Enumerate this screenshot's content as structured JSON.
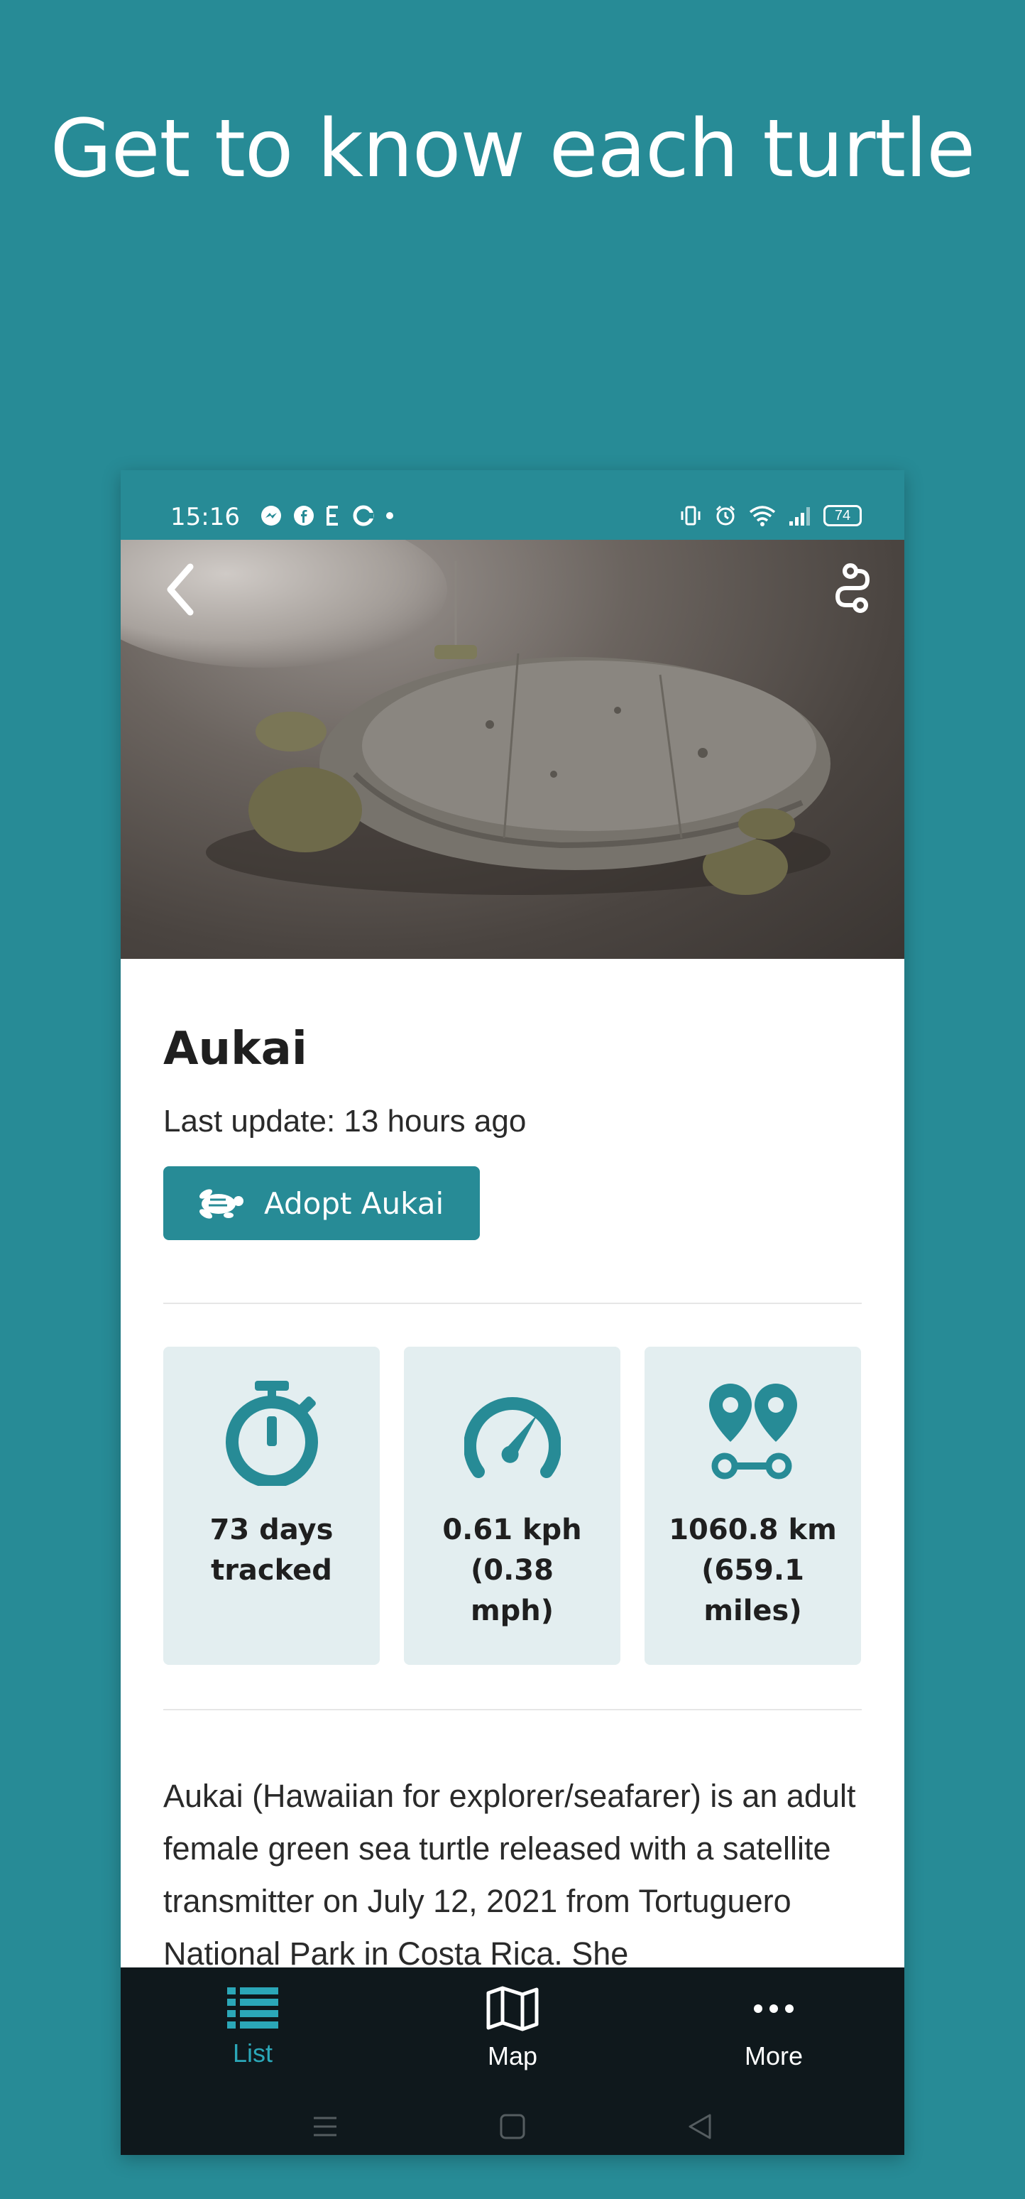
{
  "headline": "Get to know each turtle",
  "status_bar": {
    "time": "15:16",
    "battery": "74"
  },
  "turtle": {
    "name": "Aukai",
    "last_update": "Last update: 13 hours ago",
    "adopt_label": "Adopt Aukai"
  },
  "stats": [
    {
      "icon": "stopwatch-icon",
      "text": "73 days tracked"
    },
    {
      "icon": "speedometer-icon",
      "text": "0.61 kph (0.38 mph)"
    },
    {
      "icon": "distance-pins-icon",
      "text": "1060.8 km (659.1 miles)"
    }
  ],
  "description": "Aukai (Hawaiian for explorer/seafarer) is an adult female green sea turtle released with a satellite transmitter on July 12, 2021 from Tortuguero National Park in Costa Rica. She",
  "nav": {
    "list": "List",
    "map": "Map",
    "more": "More"
  },
  "colors": {
    "brand": "#278b96",
    "nav_active": "#2ba7b8",
    "nav_bg": "#0f181c",
    "card_bg": "#e3eef0"
  }
}
